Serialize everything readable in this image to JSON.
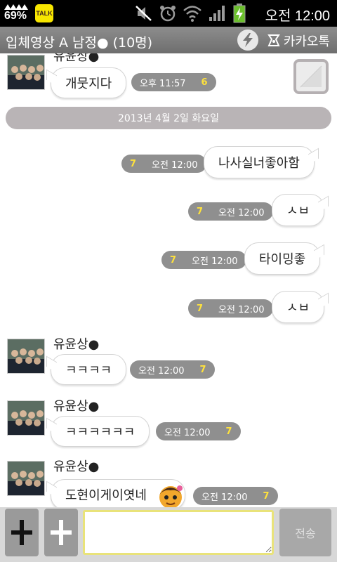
{
  "status_bar": {
    "battery_percent": "69%",
    "talk_badge": "TALK",
    "time": "오전 12:00",
    "icons": [
      "signal-icon",
      "kakaotalk-icon",
      "mute-icon",
      "alarm-icon",
      "wifi-icon",
      "cell-signal-icon",
      "battery-charging-icon"
    ]
  },
  "title_bar": {
    "title": "입체영상 A 남정● (10명)",
    "brand": "카카오톡"
  },
  "date_divider": "2013년 4월 2일 화요일",
  "messages": [
    {
      "sender": "유윤상●",
      "text": "개뭇지다",
      "time": "오후 11:57",
      "count": "6"
    },
    {
      "text": "나사실너좋아함",
      "time": "오전 12:00",
      "count": "7"
    },
    {
      "text": "ㅅㅂ",
      "time": "오전 12:00",
      "count": "7"
    },
    {
      "text": "타이밍좋",
      "time": "오전 12:00",
      "count": "7"
    },
    {
      "text": "ㅅㅂ",
      "time": "오전 12:00",
      "count": "7"
    },
    {
      "sender": "유윤상●",
      "text": "ㅋㅋㅋㅋ",
      "time": "오전 12:00",
      "count": "7"
    },
    {
      "sender": "유윤상●",
      "text": "ㅋㅋㅋㅋㅋㅋ",
      "time": "오전 12:00",
      "count": "7"
    },
    {
      "sender": "유윤상●",
      "text": "도현이게이엿네",
      "time": "오전 12:00",
      "count": "7"
    }
  ],
  "input_bar": {
    "placeholder": "",
    "send_label": "전송"
  },
  "colors": {
    "accent_yellow": "#f7e600",
    "count_yellow": "#ffe23c",
    "meta_gray": "#8f8f8f"
  }
}
